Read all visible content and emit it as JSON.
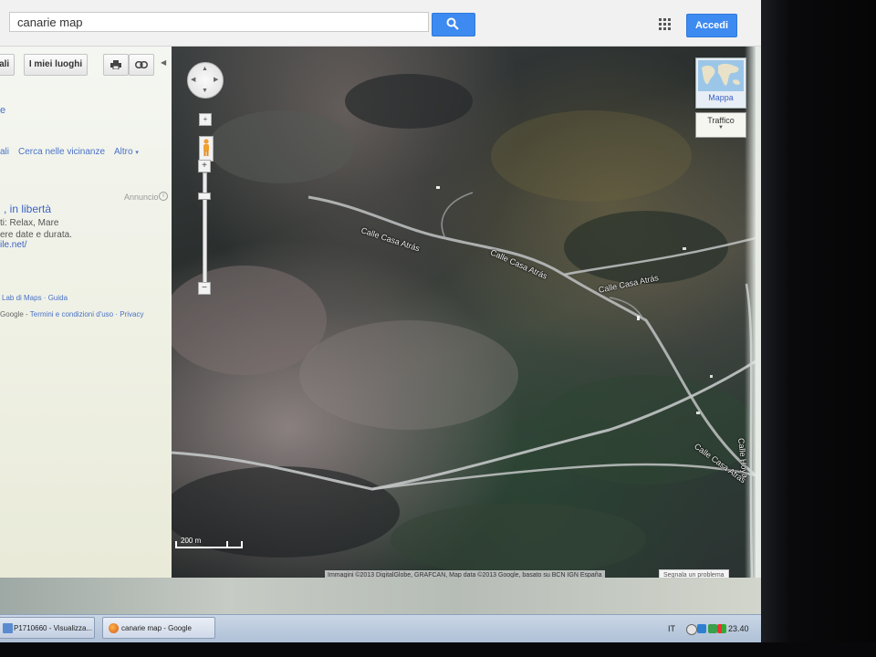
{
  "search": {
    "query": "canarie map"
  },
  "header": {
    "login_label": "Accedi"
  },
  "panel": {
    "details_label": "tali",
    "my_places_label": "I miei luoghi",
    "side_letter": "e",
    "link_fragment": "ali",
    "link_nearby": "Cerca nelle vicinanze",
    "link_more": "Altro",
    "ad_label": "Annuncio",
    "ad_title": ", in libertà",
    "ad_line1": "ti: Relax, Mare",
    "ad_line2": "ere date e durata.",
    "ad_url": "ile.net/",
    "footer_links": "Lab di Maps · Guida",
    "footer_brand": "Google",
    "footer_terms": "Termini e condizioni d'uso · Privacy"
  },
  "map": {
    "streets": [
      {
        "label": "Calle Casa Atrás"
      },
      {
        "label": "Calle Casa Atrás"
      },
      {
        "label": "Calle Casa Atrás"
      },
      {
        "label": "Calle Casa Atrás"
      },
      {
        "label": "Calle Hoya"
      }
    ],
    "map_type_label": "Mappa",
    "traffic_label": "Traffico",
    "scale_label": "200 m",
    "attribution": "Immagini ©2013 DigitalGlobe, GRAFCAN, Map data ©2013 Google, basato su BCN IGN España",
    "report_label": "Segnala un problema"
  },
  "taskbar": {
    "tasks": [
      {
        "label": "P1710660 - Visualizza..."
      },
      {
        "label": "canarie map - Google"
      }
    ],
    "lang": "IT",
    "time": "23.40"
  },
  "colors": {
    "accent": "#3d8af0",
    "link": "#3b62c4"
  }
}
